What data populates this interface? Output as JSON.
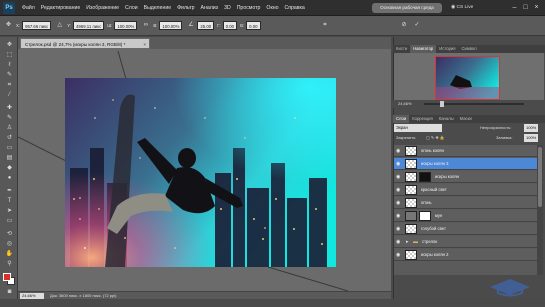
{
  "app": {
    "logo_text": "Ps"
  },
  "menu": [
    "Файл",
    "Редактирование",
    "Изображение",
    "Слои",
    "Выделение",
    "Фильтр",
    "Анализ",
    "3D",
    "Просмотр",
    "Окно",
    "Справка"
  ],
  "workspace_button": "Основная рабочая среда",
  "cs_live": "CS Live",
  "options": {
    "x_value": "957.66 пикс",
    "y_value": "4969.11 пикс",
    "w_value": "100.00%",
    "h_value": "100.00%",
    "angle_value": "25.00",
    "h_skew": "0.00",
    "v_skew": "0.00"
  },
  "document": {
    "tab_title": "Стрелок.psd @ 24,7% (искры колян 3, RGB/8) *",
    "zoom": "24,66%",
    "info": "Док: 3600 пикс. х 1800 пикс. (72 ppi)"
  },
  "panels": {
    "top_tabs": [
      "Кисти",
      "Навигатор",
      "История",
      "Символ"
    ],
    "nav_zoom": "24,66%",
    "layers_tabs": [
      "Слои",
      "Коррекция",
      "Каналы",
      "Маски"
    ],
    "blend_mode": "Экран",
    "opacity_label": "Непрозрачность:",
    "opacity_value": "100%",
    "lock_label": "Закрепить:",
    "fill_label": "Заливка:",
    "fill_value": "100%"
  },
  "layers": [
    {
      "name": "огонь колян",
      "selected": false
    },
    {
      "name": "искры колян 3",
      "selected": true
    },
    {
      "name": "искры колян",
      "selected": false
    },
    {
      "name": "красный свет",
      "selected": false
    },
    {
      "name": "огонь",
      "selected": false
    },
    {
      "name": "мун",
      "selected": false
    },
    {
      "name": "голубой свет",
      "selected": false
    },
    {
      "name": "стрелок",
      "selected": false
    },
    {
      "name": "искры колян 2",
      "selected": false
    }
  ],
  "colors": {
    "foreground": "#d8302a",
    "background": "#ffffff",
    "selection": "#4d88d6"
  }
}
